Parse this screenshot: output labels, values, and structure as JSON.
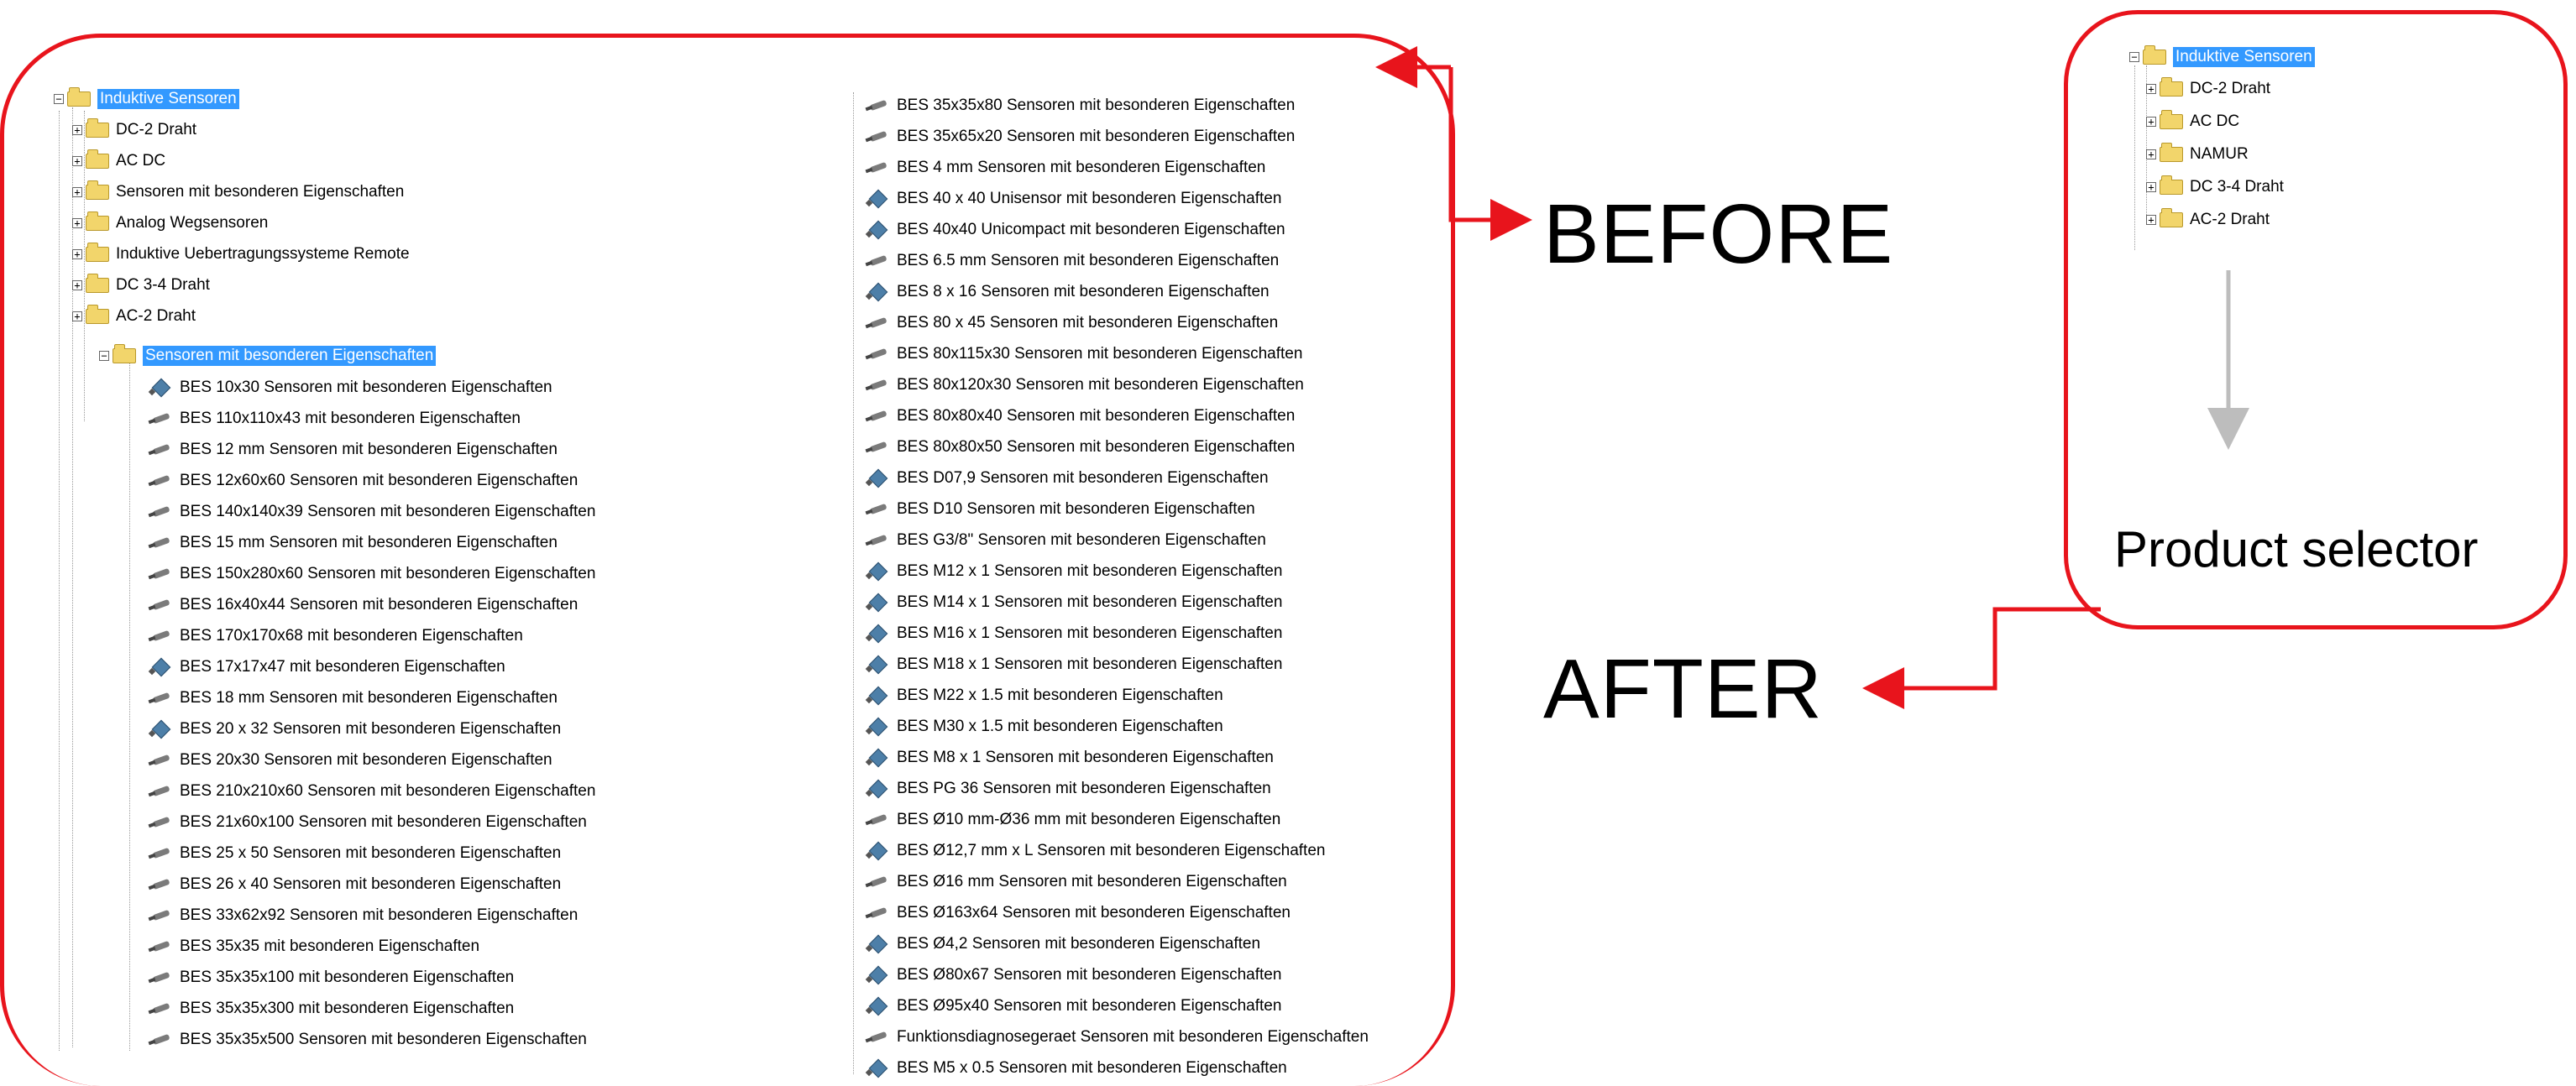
{
  "labels": {
    "before": "BEFORE",
    "after": "AFTER",
    "product_selector": "Product selector"
  },
  "before_tree": {
    "root": "Induktive Sensoren",
    "children": [
      "DC-2 Draht",
      "AC DC",
      "Sensoren mit besonderen Eigenschaften",
      "Analog Wegsensoren",
      "Induktive Uebertragungssysteme Remote",
      "DC 3-4 Draht",
      "AC-2 Draht"
    ],
    "expanded_folder": "Sensoren mit besonderen Eigenschaften",
    "items_left": [
      {
        "label": "BES 10x30 Sensoren mit besonderen Eigenschaften",
        "icon": "blue"
      },
      {
        "label": "BES 110x110x43 mit besonderen Eigenschaften",
        "icon": "gray"
      },
      {
        "label": "BES 12 mm Sensoren mit besonderen Eigenschaften",
        "icon": "gray"
      },
      {
        "label": "BES 12x60x60 Sensoren mit besonderen Eigenschaften",
        "icon": "gray"
      },
      {
        "label": "BES 140x140x39 Sensoren mit besonderen Eigenschaften",
        "icon": "gray"
      },
      {
        "label": "BES 15 mm Sensoren mit besonderen Eigenschaften",
        "icon": "gray"
      },
      {
        "label": "BES 150x280x60 Sensoren mit besonderen Eigenschaften",
        "icon": "gray"
      },
      {
        "label": "BES 16x40x44 Sensoren mit besonderen Eigenschaften",
        "icon": "gray"
      },
      {
        "label": "BES 170x170x68 mit besonderen Eigenschaften",
        "icon": "gray"
      },
      {
        "label": "BES 17x17x47 mit besonderen Eigenschaften",
        "icon": "blue"
      },
      {
        "label": "BES 18 mm Sensoren mit besonderen Eigenschaften",
        "icon": "gray"
      },
      {
        "label": "BES 20 x 32 Sensoren mit besonderen Eigenschaften",
        "icon": "blue"
      },
      {
        "label": "BES 20x30 Sensoren mit besonderen Eigenschaften",
        "icon": "gray"
      },
      {
        "label": "BES 210x210x60 Sensoren mit besonderen Eigenschaften",
        "icon": "gray"
      },
      {
        "label": "BES 21x60x100 Sensoren mit besonderen Eigenschaften",
        "icon": "gray"
      },
      {
        "label": "BES 25 x 50 Sensoren mit besonderen Eigenschaften",
        "icon": "gray"
      },
      {
        "label": "BES 26 x 40 Sensoren mit besonderen Eigenschaften",
        "icon": "gray"
      },
      {
        "label": "BES 33x62x92 Sensoren mit besonderen Eigenschaften",
        "icon": "gray"
      },
      {
        "label": "BES 35x35 mit besonderen Eigenschaften",
        "icon": "gray"
      },
      {
        "label": "BES 35x35x100 mit besonderen Eigenschaften",
        "icon": "gray"
      },
      {
        "label": "BES 35x35x300 mit besonderen Eigenschaften",
        "icon": "gray"
      },
      {
        "label": "BES 35x35x500 Sensoren mit besonderen Eigenschaften",
        "icon": "gray"
      }
    ],
    "items_right": [
      {
        "label": "BES 35x35x80 Sensoren mit besonderen Eigenschaften",
        "icon": "gray"
      },
      {
        "label": "BES 35x65x20 Sensoren mit besonderen Eigenschaften",
        "icon": "gray"
      },
      {
        "label": "BES 4 mm Sensoren mit besonderen Eigenschaften",
        "icon": "gray"
      },
      {
        "label": "BES 40 x 40 Unisensor mit besonderen Eigenschaften",
        "icon": "blue"
      },
      {
        "label": "BES 40x40 Unicompact mit besonderen Eigenschaften",
        "icon": "blue"
      },
      {
        "label": "BES 6.5 mm Sensoren mit besonderen Eigenschaften",
        "icon": "gray"
      },
      {
        "label": "BES 8 x 16 Sensoren mit besonderen Eigenschaften",
        "icon": "blue"
      },
      {
        "label": "BES 80 x 45 Sensoren mit besonderen Eigenschaften",
        "icon": "gray"
      },
      {
        "label": "BES 80x115x30 Sensoren mit besonderen Eigenschaften",
        "icon": "gray"
      },
      {
        "label": "BES 80x120x30 Sensoren mit besonderen Eigenschaften",
        "icon": "gray"
      },
      {
        "label": "BES 80x80x40 Sensoren mit besonderen Eigenschaften",
        "icon": "gray"
      },
      {
        "label": "BES 80x80x50 Sensoren mit besonderen Eigenschaften",
        "icon": "gray"
      },
      {
        "label": "BES D07,9 Sensoren mit besonderen Eigenschaften",
        "icon": "blue"
      },
      {
        "label": "BES D10 Sensoren mit besonderen Eigenschaften",
        "icon": "gray"
      },
      {
        "label": "BES G3/8\" Sensoren mit besonderen Eigenschaften",
        "icon": "gray"
      },
      {
        "label": "BES M12 x 1 Sensoren mit besonderen Eigenschaften",
        "icon": "blue"
      },
      {
        "label": "BES M14 x 1 Sensoren mit besonderen Eigenschaften",
        "icon": "blue"
      },
      {
        "label": "BES M16 x 1 Sensoren mit besonderen Eigenschaften",
        "icon": "blue"
      },
      {
        "label": "BES M18 x 1 Sensoren mit besonderen Eigenschaften",
        "icon": "blue"
      },
      {
        "label": "BES M22 x 1.5 mit besonderen Eigenschaften",
        "icon": "blue"
      },
      {
        "label": "BES M30 x 1.5 mit besonderen Eigenschaften",
        "icon": "blue"
      },
      {
        "label": "BES M8 x 1 Sensoren mit besonderen Eigenschaften",
        "icon": "blue"
      },
      {
        "label": "BES PG 36 Sensoren mit besonderen Eigenschaften",
        "icon": "blue"
      },
      {
        "label": "BES Ø10 mm-Ø36 mm mit besonderen Eigenschaften",
        "icon": "gray"
      },
      {
        "label": "BES Ø12,7 mm x L Sensoren mit besonderen Eigenschaften",
        "icon": "blue"
      },
      {
        "label": "BES Ø16 mm Sensoren mit besonderen Eigenschaften",
        "icon": "gray"
      },
      {
        "label": "BES Ø163x64 Sensoren mit besonderen Eigenschaften",
        "icon": "gray"
      },
      {
        "label": "BES Ø4,2 Sensoren mit besonderen Eigenschaften",
        "icon": "blue"
      },
      {
        "label": "BES Ø80x67 Sensoren mit besonderen Eigenschaften",
        "icon": "blue"
      },
      {
        "label": "BES Ø95x40 Sensoren mit besonderen Eigenschaften",
        "icon": "blue"
      },
      {
        "label": "Funktionsdiagnosegeraet Sensoren mit besonderen Eigenschaften",
        "icon": "gray"
      },
      {
        "label": "BES M5 x 0.5 Sensoren mit besonderen Eigenschaften",
        "icon": "blue"
      }
    ]
  },
  "after_tree": {
    "root": "Induktive Sensoren",
    "children": [
      "DC-2 Draht",
      "AC DC",
      "NAMUR",
      "DC 3-4 Draht",
      "AC-2 Draht"
    ]
  },
  "colors": {
    "frame": "#e8141c",
    "selection": "#3399ff",
    "arrow_gray": "#bdbdbd"
  }
}
